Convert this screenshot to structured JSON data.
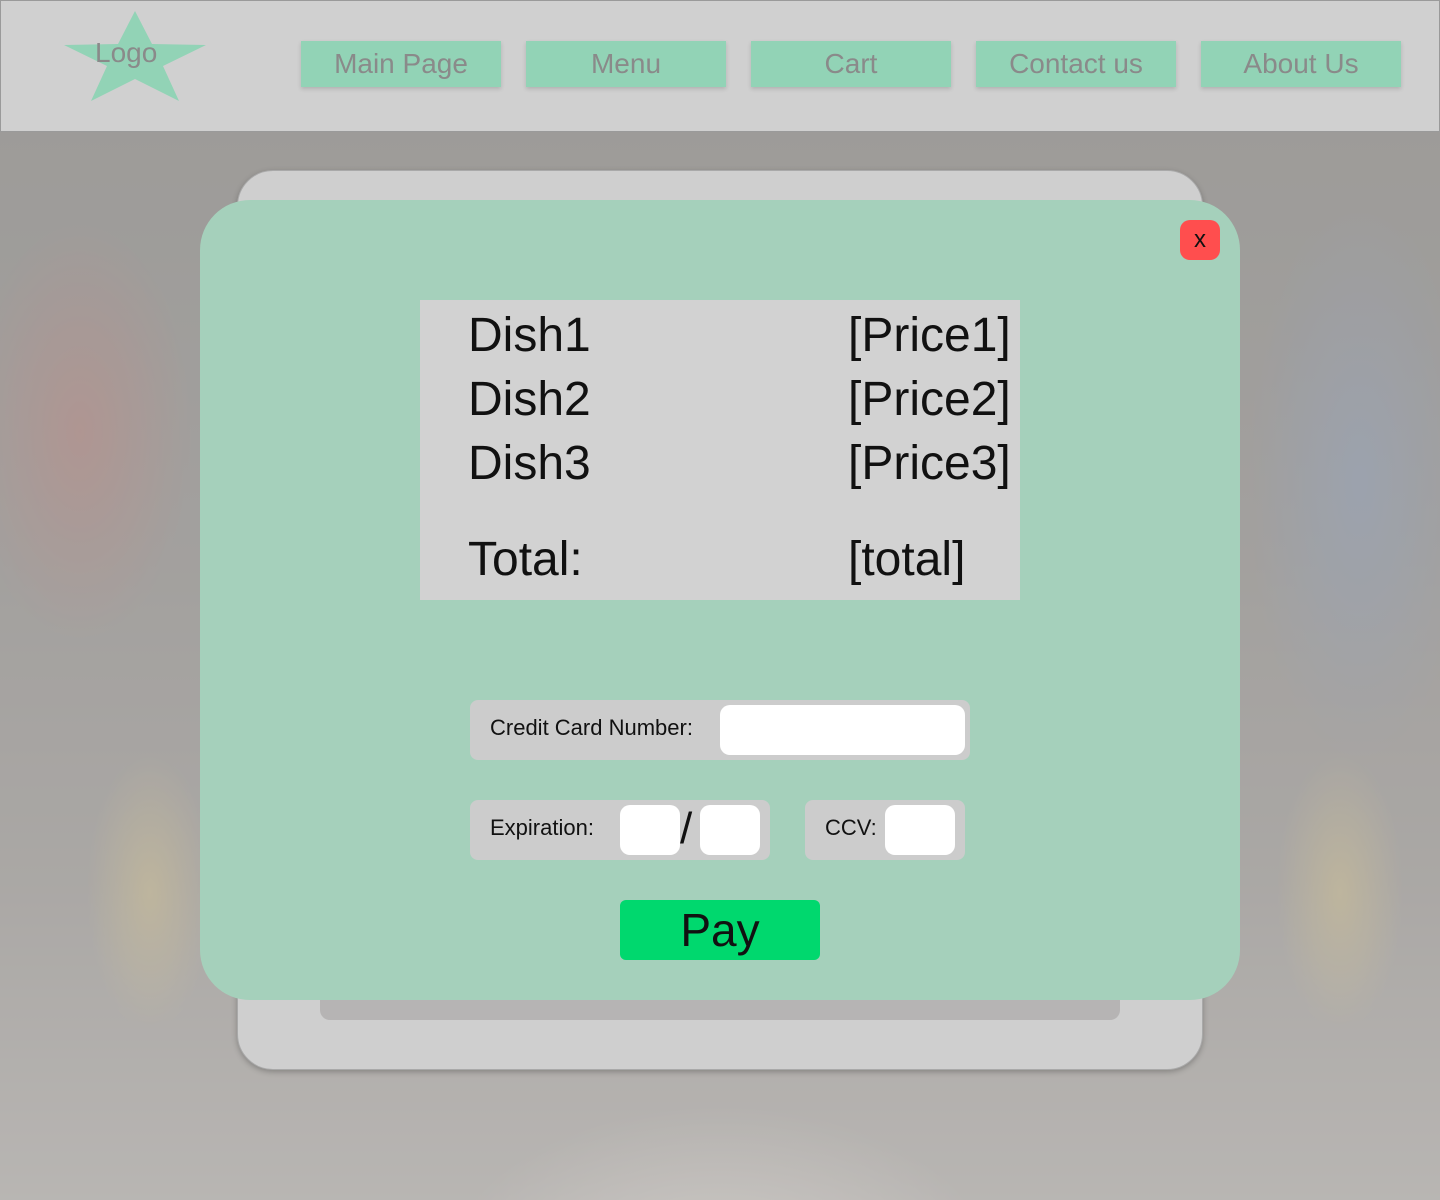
{
  "header": {
    "logo_text": "Logo",
    "nav": [
      {
        "label": "Main Page"
      },
      {
        "label": "Menu"
      },
      {
        "label": "Cart"
      },
      {
        "label": "Contact us"
      },
      {
        "label": "About Us"
      }
    ]
  },
  "modal": {
    "close_label": "x",
    "items": [
      {
        "name": "Dish1",
        "price": "[Price1]"
      },
      {
        "name": "Dish2",
        "price": "[Price2]"
      },
      {
        "name": "Dish3",
        "price": "[Price3]"
      }
    ],
    "total_label": "Total:",
    "total_value": "[total]",
    "card_number_label": "Credit Card Number:",
    "expiration_label": "Expiration:",
    "expiration_separator": "/",
    "ccv_label": "CCV:",
    "pay_label": "Pay"
  },
  "colors": {
    "accent_green": "#92d3b6",
    "modal_bg": "#a5d0bb",
    "pay_button": "#00d86e",
    "close_button": "#ff4e4e"
  }
}
